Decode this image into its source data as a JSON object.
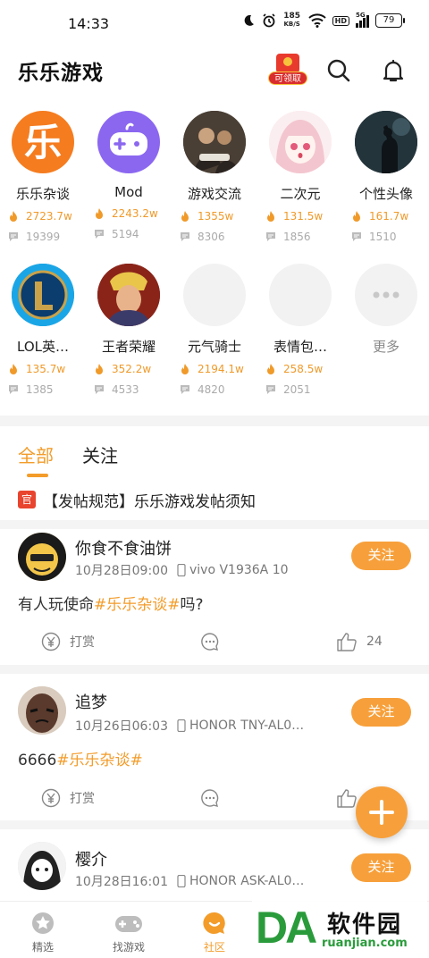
{
  "status_bar": {
    "time": "14:33",
    "speed_value": "185",
    "speed_unit": "KB/S",
    "hd": "HD",
    "network": "5G",
    "battery": "79"
  },
  "header": {
    "title": "乐乐游戏",
    "red_packet_label": "可领取"
  },
  "circles": [
    {
      "name": "乐乐杂谈",
      "heat": "2723.7w",
      "posts": "19399"
    },
    {
      "name": "Mod",
      "heat": "2243.2w",
      "posts": "5194"
    },
    {
      "name": "游戏交流",
      "heat": "1355w",
      "posts": "8306"
    },
    {
      "name": "二次元",
      "heat": "131.5w",
      "posts": "1856"
    },
    {
      "name": "个性头像",
      "heat": "161.7w",
      "posts": "1510"
    },
    {
      "name": "LOL英…",
      "heat": "135.7w",
      "posts": "1385"
    },
    {
      "name": "王者荣耀",
      "heat": "352.2w",
      "posts": "4533"
    },
    {
      "name": "元气骑士",
      "heat": "2194.1w",
      "posts": "4820"
    },
    {
      "name": "表情包…",
      "heat": "258.5w",
      "posts": "2051"
    },
    {
      "name": "更多"
    }
  ],
  "tabs": {
    "all": "全部",
    "follow": "关注"
  },
  "notice": {
    "badge": "官",
    "text": "【发帖规范】乐乐游戏发帖须知"
  },
  "posts": [
    {
      "user": "你食不食油饼",
      "date": "10月28日09:00",
      "device": "vivo V1936A 10",
      "text_before": "有人玩使命",
      "hashtag": "#乐乐杂谈#",
      "text_after": "吗?",
      "follow": "关注",
      "reward": "打赏",
      "likes": "24"
    },
    {
      "user": "追梦",
      "date": "10月26日06:03",
      "device": "HONOR TNY-AL0…",
      "text_before": "6666",
      "hashtag": "#乐乐杂谈#",
      "text_after": "",
      "follow": "关注",
      "reward": "打赏",
      "likes": ""
    },
    {
      "user": "樱介",
      "date": "10月28日16:01",
      "device": "HONOR ASK-AL0…",
      "follow": "关注"
    }
  ],
  "bottom_nav": [
    {
      "label": "精选",
      "active": false
    },
    {
      "label": "找游戏",
      "active": false
    },
    {
      "label": "社区",
      "active": true
    }
  ],
  "watermark": {
    "brand": "DA",
    "name": "软件园",
    "url": "ruanjian.com"
  },
  "colors": {
    "accent": "#f39c2a",
    "follow_button": "#f7a03b",
    "official_red": "#e8442e",
    "watermark_green": "#2a9b3b"
  }
}
